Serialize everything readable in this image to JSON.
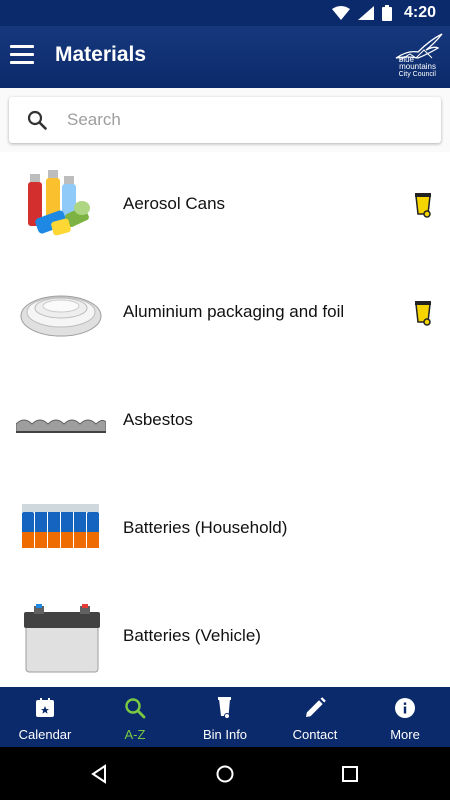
{
  "status_bar": {
    "time": "4:20"
  },
  "app_bar": {
    "title": "Materials",
    "logo": {
      "line1": "blue",
      "line2": "mountains",
      "line3": "City Council"
    }
  },
  "search": {
    "placeholder": "Search",
    "value": ""
  },
  "materials": [
    {
      "name": "Aerosol Cans",
      "bin": "yellow-recycling-bin"
    },
    {
      "name": "Aluminium packaging and foil",
      "bin": "yellow-recycling-bin"
    },
    {
      "name": "Asbestos",
      "bin": ""
    },
    {
      "name": "Batteries (Household)",
      "bin": ""
    },
    {
      "name": "Batteries (Vehicle)",
      "bin": ""
    }
  ],
  "bottom_nav": {
    "items": [
      {
        "label": "Calendar",
        "icon": "calendar-icon",
        "active": false
      },
      {
        "label": "A-Z",
        "icon": "search-icon",
        "active": true
      },
      {
        "label": "Bin Info",
        "icon": "bin-icon",
        "active": false
      },
      {
        "label": "Contact",
        "icon": "pencil-icon",
        "active": false
      },
      {
        "label": "More",
        "icon": "info-icon",
        "active": false
      }
    ]
  },
  "colors": {
    "primary": "#0b2a6b",
    "active_tab": "#7ac943",
    "recycling_bin": "#f5d400"
  }
}
